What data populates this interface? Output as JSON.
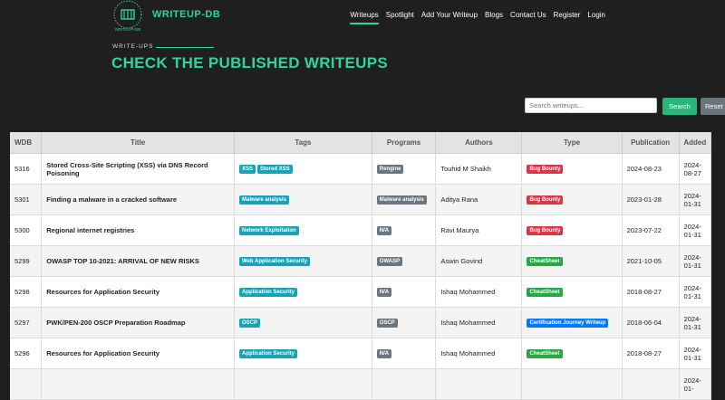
{
  "brand": "WRITEUP-DB",
  "logo_text": "WRITEUP-DB",
  "nav": [
    "Writeups",
    "Spotlight",
    "Add Your Writeup",
    "Blogs",
    "Contact Us",
    "Register",
    "Login"
  ],
  "section_label": "WRITE-UPS",
  "page_title": "CHECK THE PUBLISHED WRITEUPS",
  "search": {
    "placeholder": "Search writeups...",
    "button": "Search",
    "reset": "Reset"
  },
  "columns": [
    "WDB",
    "Title",
    "Tags",
    "Programs",
    "Authors",
    "Type",
    "Publication",
    "Added"
  ],
  "rows": [
    {
      "wdb": "5316",
      "title": "Stored Cross-Site Scripting (XSS) via DNS Record Poisoning",
      "tags": [
        "XSS",
        "Stored XSS"
      ],
      "programs": [
        "Rengine"
      ],
      "author": "Touhid M Shaikh",
      "type": "Bug Bounty",
      "type_color": "bug",
      "publication": "2024-08-23",
      "added": "2024-08-27"
    },
    {
      "wdb": "5301",
      "title": "Finding a malware in a cracked software",
      "tags": [
        "Malware analysis"
      ],
      "programs": [
        "Malware analysis"
      ],
      "author": "Aditya Rana",
      "type": "Bug Bounty",
      "type_color": "bug",
      "publication": "2023-01-28",
      "added": "2024-01-31"
    },
    {
      "wdb": "5300",
      "title": "Regional internet registries",
      "tags": [
        "Network Exploitation"
      ],
      "programs": [
        "N/A"
      ],
      "author": "Ravi Maurya",
      "type": "Bug Bounty",
      "type_color": "bug",
      "publication": "2023-07-22",
      "added": "2024-01-31"
    },
    {
      "wdb": "5299",
      "title": "OWASP TOP 10-2021: ARRIVAL OF NEW RISKS",
      "tags": [
        "Web Application Security"
      ],
      "programs": [
        "OWASP"
      ],
      "author": "Aswin Govind",
      "type": "CheatSheet",
      "type_color": "cheat",
      "publication": "2021-10-05",
      "added": "2024-01-31"
    },
    {
      "wdb": "5298",
      "title": "Resources for Application Security",
      "tags": [
        "Application Security"
      ],
      "programs": [
        "N/A"
      ],
      "author": "Ishaq Mohammed",
      "type": "CheatSheet",
      "type_color": "cheat",
      "publication": "2018-08-27",
      "added": "2024-01-31"
    },
    {
      "wdb": "5297",
      "title": "PWK/PEN-200 OSCP Preparation Roadmap",
      "tags": [
        "OSCP"
      ],
      "programs": [
        "OSCP"
      ],
      "author": "Ishaq Mohammed",
      "type": "Certification Journey Writeup",
      "type_color": "cert",
      "publication": "2018-06-04",
      "added": "2024-01-31"
    },
    {
      "wdb": "5296",
      "title": "Resources for Application Security",
      "tags": [
        "Application Security"
      ],
      "programs": [
        "N/A"
      ],
      "author": "Ishaq Mohammed",
      "type": "CheatSheet",
      "type_color": "cheat",
      "publication": "2018-08-27",
      "added": "2024-01-31"
    },
    {
      "wdb": "",
      "title": "",
      "tags": [
        ""
      ],
      "programs": [
        ""
      ],
      "author": "",
      "type": "",
      "type_color": "cheat",
      "publication": "",
      "added": "2024-01-"
    }
  ],
  "colors": {
    "accent": "#2ed3a0",
    "bg": "#1e1e1e",
    "bug": "#dc3545",
    "cheat": "#28a745",
    "cert": "#007bff",
    "tag": "#17a2b8",
    "program": "#6c757d"
  }
}
